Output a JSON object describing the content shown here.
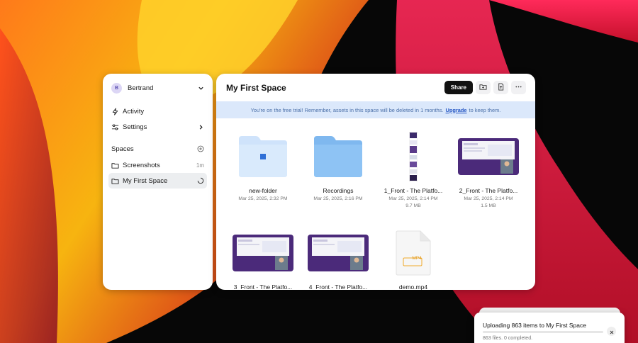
{
  "colors": {
    "accent": "#2557c4",
    "banner_bg": "#dbe8fb",
    "folder_light": "#cfe3fb",
    "folder_blue": "#8ec3f4",
    "video_thumb": "#4b2a7a"
  },
  "sidebar": {
    "user": {
      "initial": "B",
      "name": "Bertrand"
    },
    "nav": [
      {
        "label": "Activity",
        "icon": "lightning-icon"
      },
      {
        "label": "Settings",
        "icon": "sliders-icon"
      }
    ],
    "spaces_label": "Spaces",
    "spaces": [
      {
        "label": "Screenshots",
        "meta": "1m",
        "icon": "folder-icon"
      },
      {
        "label": "My First Space",
        "meta": "",
        "icon": "folder-icon",
        "active": true
      }
    ]
  },
  "main": {
    "title": "My First Space",
    "share_label": "Share",
    "banner": {
      "text_before": "You're on the free trial! Remember, assets in this space will be deleted in 1 months.",
      "link": "Upgrade",
      "text_after": "to keep them."
    },
    "files": [
      {
        "name": "new-folder",
        "date": "Mar 25, 2025, 2:32 PM",
        "size": "",
        "kind": "folder-light"
      },
      {
        "name": "Recordings",
        "date": "Mar 25, 2025, 2:16 PM",
        "size": "",
        "kind": "folder-blue"
      },
      {
        "name": "1_Front - The Platfo...",
        "date": "Mar 25, 2025, 2:14 PM",
        "size": "9.7 MB",
        "kind": "tall-image"
      },
      {
        "name": "2_Front - The Platfo...",
        "date": "Mar 25, 2025, 2:14 PM",
        "size": "1.5 MB",
        "kind": "video"
      },
      {
        "name": "3_Front - The Platfo...",
        "date": "",
        "size": "",
        "kind": "video"
      },
      {
        "name": "4_Front - The Platfo...",
        "date": "",
        "size": "",
        "kind": "video"
      },
      {
        "name": "demo.mp4",
        "date": "",
        "size": "",
        "kind": "file",
        "badge": "MP4"
      }
    ]
  },
  "upload": {
    "title": "Uploading 863 items to My First Space",
    "status": "863 files. 0 completed.",
    "progress": 0
  }
}
